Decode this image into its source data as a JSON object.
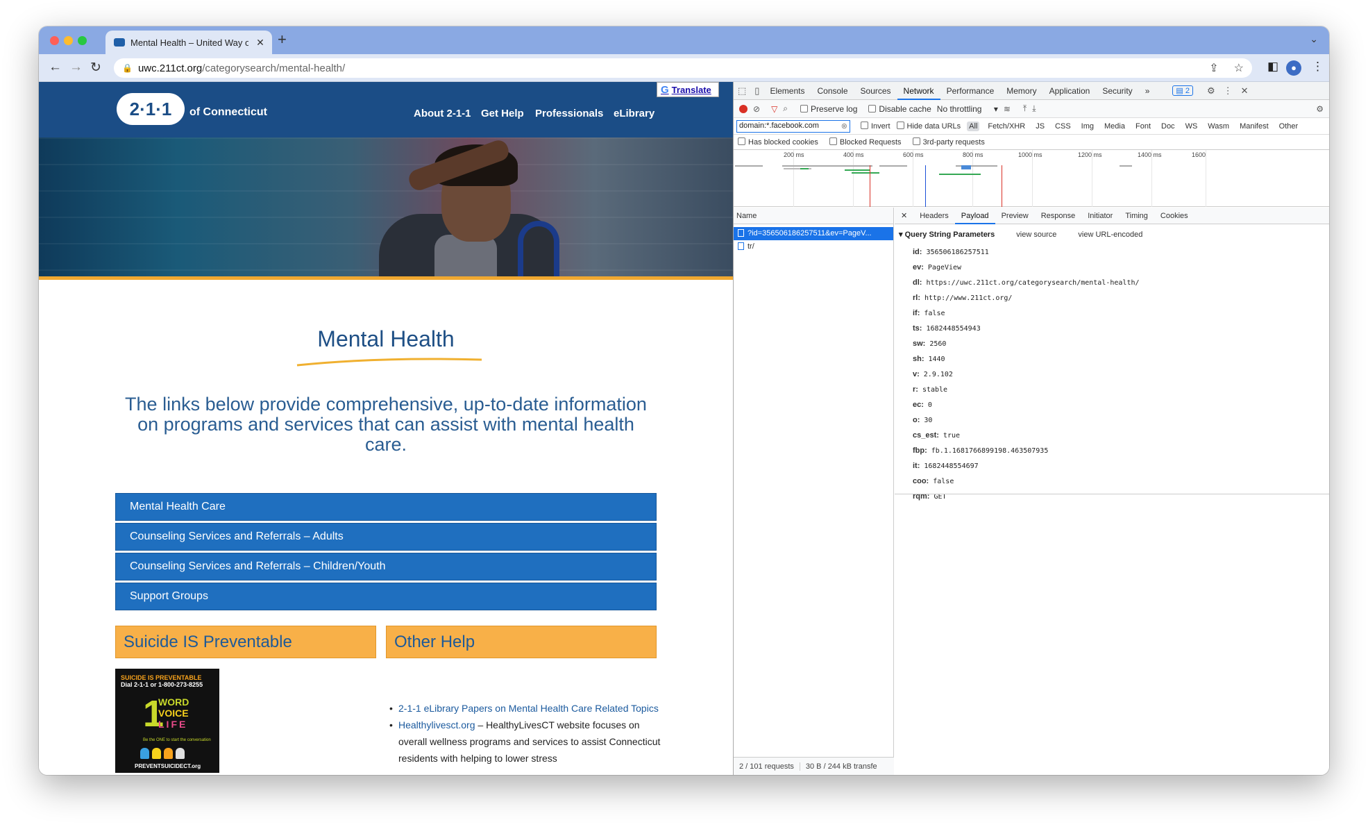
{
  "browser": {
    "tab_title": "Mental Health – United Way of",
    "url_host": "uwc.211ct.org",
    "url_path": "/categorysearch/mental-health/",
    "new_tab": "+",
    "close": "✕"
  },
  "site": {
    "logo": "2·1·1",
    "logo_sub": "of Connecticut",
    "nav": [
      "About 2-1-1",
      "Get Help",
      "Professionals",
      "eLibrary"
    ],
    "translate": "Translate",
    "title": "Mental Health",
    "intro": "The links below provide comprehensive, up-to-date information on programs and services that can assist with mental health care.",
    "buttons": [
      "Mental Health Care",
      "Counseling Services and Referrals – Adults",
      "Counseling Services and Referrals – Children/Youth",
      "Support Groups"
    ],
    "box_left": "Suicide IS Preventable",
    "box_right": "Other Help",
    "poster": {
      "line1": "SUICIDE IS PREVENTABLE",
      "line2": "Dial 2-1-1 or 1-800-273-8255",
      "num": "1",
      "w1": "WORD",
      "w2": "VOICE",
      "w3": "LIFE",
      "tag": "Be the ONE to start the conversation",
      "site": "PREVENTSUICIDECT.org"
    },
    "links": [
      {
        "link": "2-1-1 eLibrary Papers on Mental Health Care Related Topics",
        "rest": ""
      },
      {
        "link": "Healthylivesct.org",
        "rest": " – HealthyLivesCT website focuses on overall wellness programs and services to assist Connecticut residents with helping to lower stress"
      }
    ]
  },
  "devtools": {
    "tabs": [
      "Elements",
      "Console",
      "Sources",
      "Network",
      "Performance",
      "Memory",
      "Application",
      "Security"
    ],
    "selected_tab": "Network",
    "more": "»",
    "issues_count": "2",
    "preserve_log": "Preserve log",
    "disable_cache": "Disable cache",
    "throttling": "No throttling",
    "filter_value": "domain:*.facebook.com",
    "invert": "Invert",
    "hide_data_urls": "Hide data URLs",
    "types": [
      "All",
      "Fetch/XHR",
      "JS",
      "CSS",
      "Img",
      "Media",
      "Font",
      "Doc",
      "WS",
      "Wasm",
      "Manifest",
      "Other"
    ],
    "has_blocked_cookies": "Has blocked cookies",
    "blocked_requests": "Blocked Requests",
    "third_party": "3rd-party requests",
    "timeline_ticks": [
      "200 ms",
      "400 ms",
      "600 ms",
      "800 ms",
      "1000 ms",
      "1200 ms",
      "1400 ms",
      "1600"
    ],
    "name_header": "Name",
    "requests": [
      "?id=356506186257511&ev=PageV...",
      "tr/"
    ],
    "status_requests": "2 / 101 requests",
    "status_transfer": "30 B / 244 kB transfe",
    "detail_tabs": [
      "Headers",
      "Payload",
      "Preview",
      "Response",
      "Initiator",
      "Timing",
      "Cookies"
    ],
    "detail_selected": "Payload",
    "qsp_title": "Query String Parameters",
    "view_source": "view source",
    "view_url_encoded": "view URL-encoded",
    "params": [
      {
        "k": "id:",
        "v": "356506186257511"
      },
      {
        "k": "ev:",
        "v": "PageView"
      },
      {
        "k": "dl:",
        "v": "https://uwc.211ct.org/categorysearch/mental-health/"
      },
      {
        "k": "rl:",
        "v": "http://www.211ct.org/"
      },
      {
        "k": "if:",
        "v": "false"
      },
      {
        "k": "ts:",
        "v": "1682448554943"
      },
      {
        "k": "sw:",
        "v": "2560"
      },
      {
        "k": "sh:",
        "v": "1440"
      },
      {
        "k": "v:",
        "v": "2.9.102"
      },
      {
        "k": "r:",
        "v": "stable"
      },
      {
        "k": "ec:",
        "v": "0"
      },
      {
        "k": "o:",
        "v": "30"
      },
      {
        "k": "cs_est:",
        "v": "true"
      },
      {
        "k": "fbp:",
        "v": "fb.1.1681766899198.463507935"
      },
      {
        "k": "it:",
        "v": "1682448554697"
      },
      {
        "k": "coo:",
        "v": "false"
      },
      {
        "k": "rqm:",
        "v": "GET"
      }
    ]
  },
  "colors": {
    "brand_blue": "#1b4d86",
    "button_blue": "#1f6fbf",
    "gold": "#f8b048",
    "devtools_accent": "#1a73e8"
  }
}
